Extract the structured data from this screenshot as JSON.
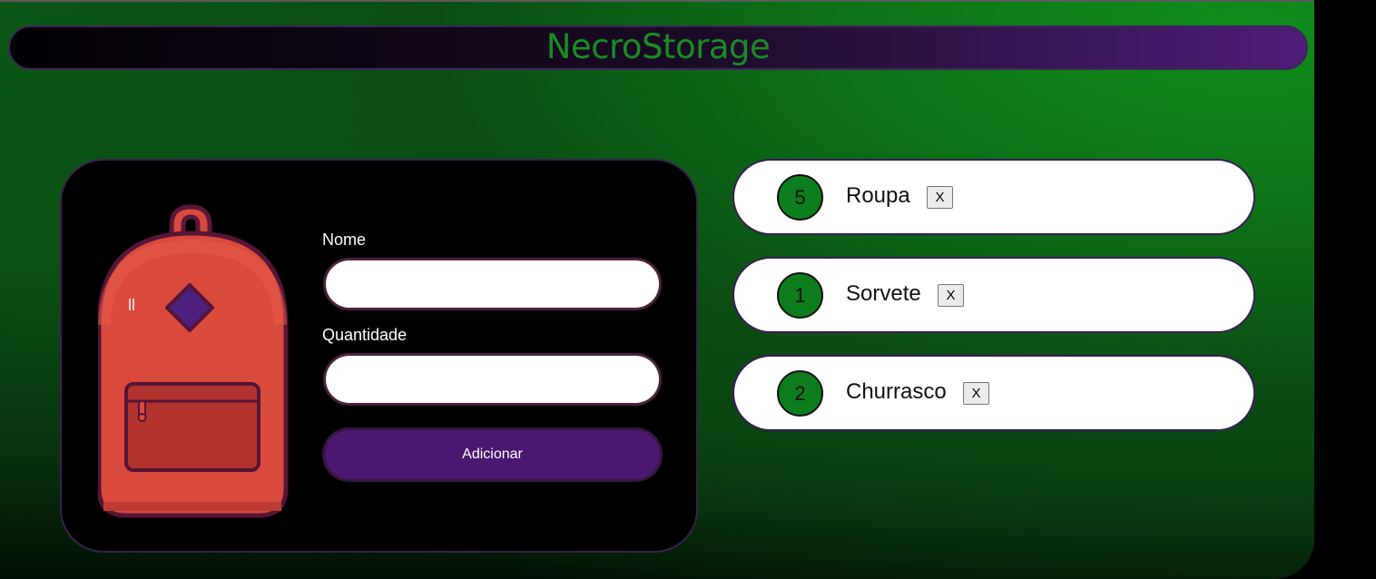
{
  "app": {
    "title": "NecroStorage"
  },
  "form": {
    "name_label": "Nome",
    "name_value": "",
    "quantity_label": "Quantidade",
    "quantity_value": "",
    "add_button_label": "Adicionar"
  },
  "items": [
    {
      "quantity": "5",
      "name": "Roupa",
      "delete_label": "X"
    },
    {
      "quantity": "1",
      "name": "Sorvete",
      "delete_label": "X"
    },
    {
      "quantity": "2",
      "name": "Churrasco",
      "delete_label": "X"
    }
  ],
  "colors": {
    "brand_green": "#1b8b25",
    "accent_purple": "#4b1770",
    "backpack_red": "#d94a3d",
    "badge_green": "#0d7c1d"
  },
  "icons": {
    "backpack": "backpack-icon"
  }
}
